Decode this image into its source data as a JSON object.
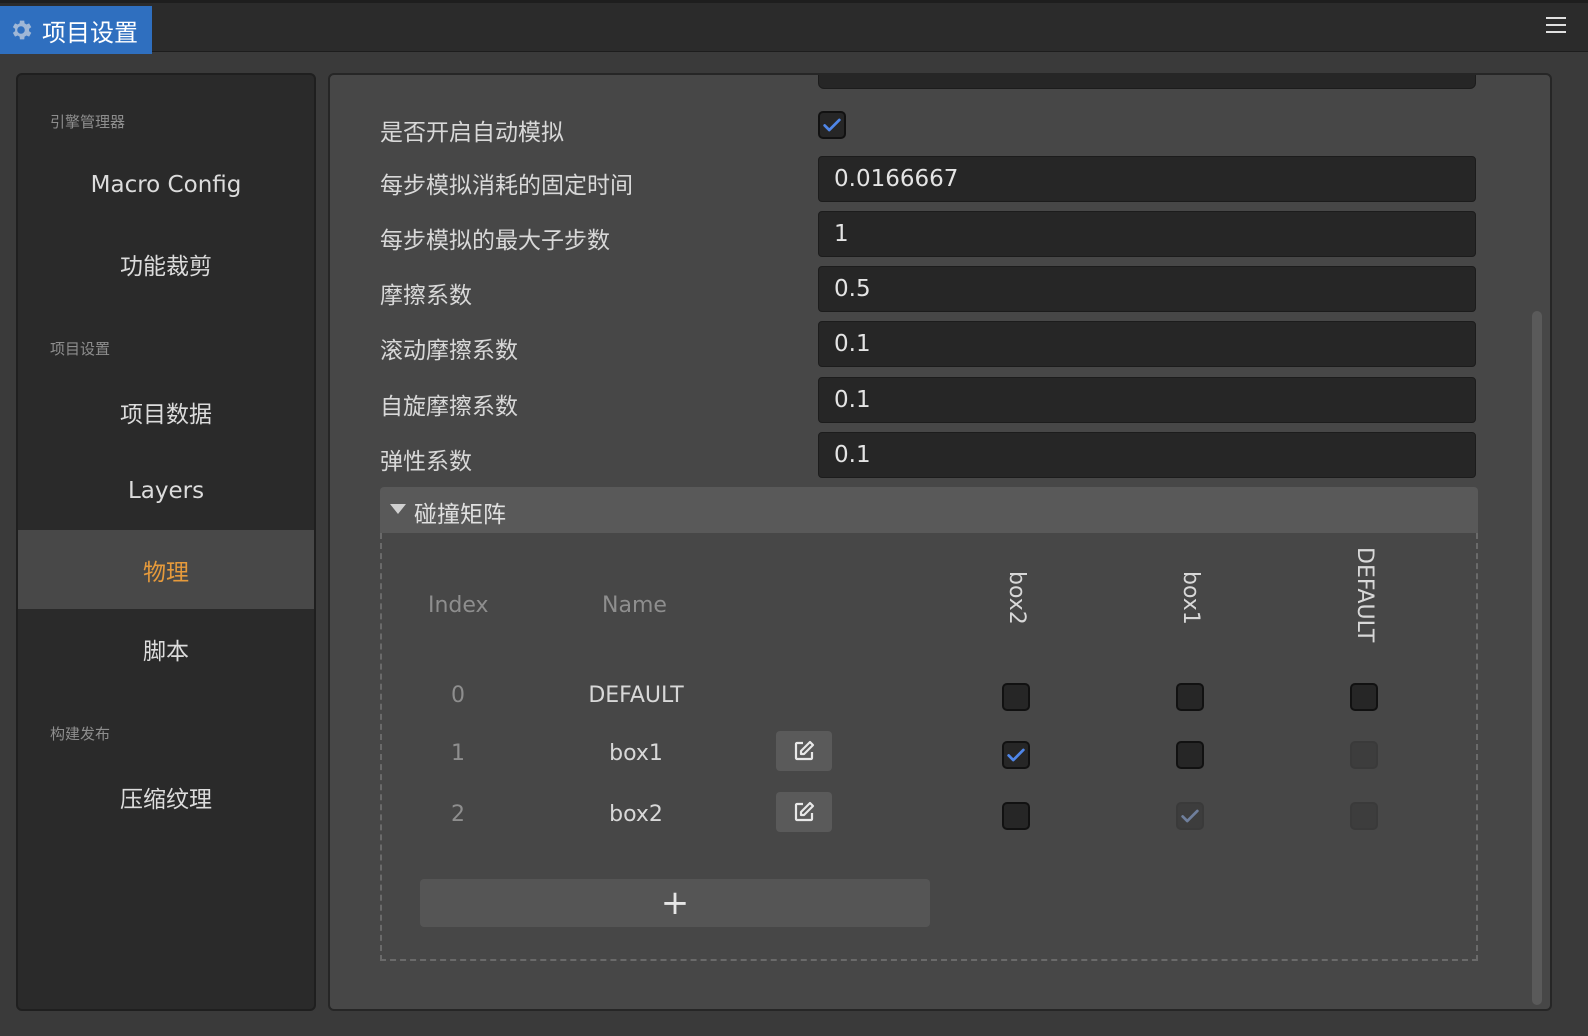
{
  "window": {
    "title": "项目设置"
  },
  "sidebar": {
    "sections": [
      {
        "title": "引擎管理器",
        "items": [
          "Macro Config",
          "功能裁剪"
        ]
      },
      {
        "title": "项目设置",
        "items": [
          "项目数据",
          "Layers",
          "物理",
          "脚本"
        ]
      },
      {
        "title": "构建发布",
        "items": [
          "压缩纹理"
        ]
      }
    ],
    "active_item": "物理"
  },
  "physics": {
    "auto_simulate": {
      "label": "是否开启自动模拟",
      "checked": true
    },
    "fixed_time_step": {
      "label": "每步模拟消耗的固定时间",
      "value": "0.0166667"
    },
    "max_sub_steps": {
      "label": "每步模拟的最大子步数",
      "value": "1"
    },
    "friction": {
      "label": "摩擦系数",
      "value": "0.5"
    },
    "rolling_friction": {
      "label": "滚动摩擦系数",
      "value": "0.1"
    },
    "spinning_friction": {
      "label": "自旋摩擦系数",
      "value": "0.1"
    },
    "restitution": {
      "label": "弹性系数",
      "value": "0.1"
    }
  },
  "collision_matrix": {
    "title": "碰撞矩阵",
    "headers": {
      "index": "Index",
      "name": "Name"
    },
    "columns": [
      "box2",
      "box1",
      "DEFAULT"
    ],
    "rows": [
      {
        "index": "0",
        "name": "DEFAULT"
      },
      {
        "index": "1",
        "name": "box1"
      },
      {
        "index": "2",
        "name": "box2"
      }
    ],
    "add_label": "+"
  },
  "colors": {
    "accent": "#e69a3b",
    "tab": "#2f6fbf",
    "check": "#4f86e8"
  }
}
